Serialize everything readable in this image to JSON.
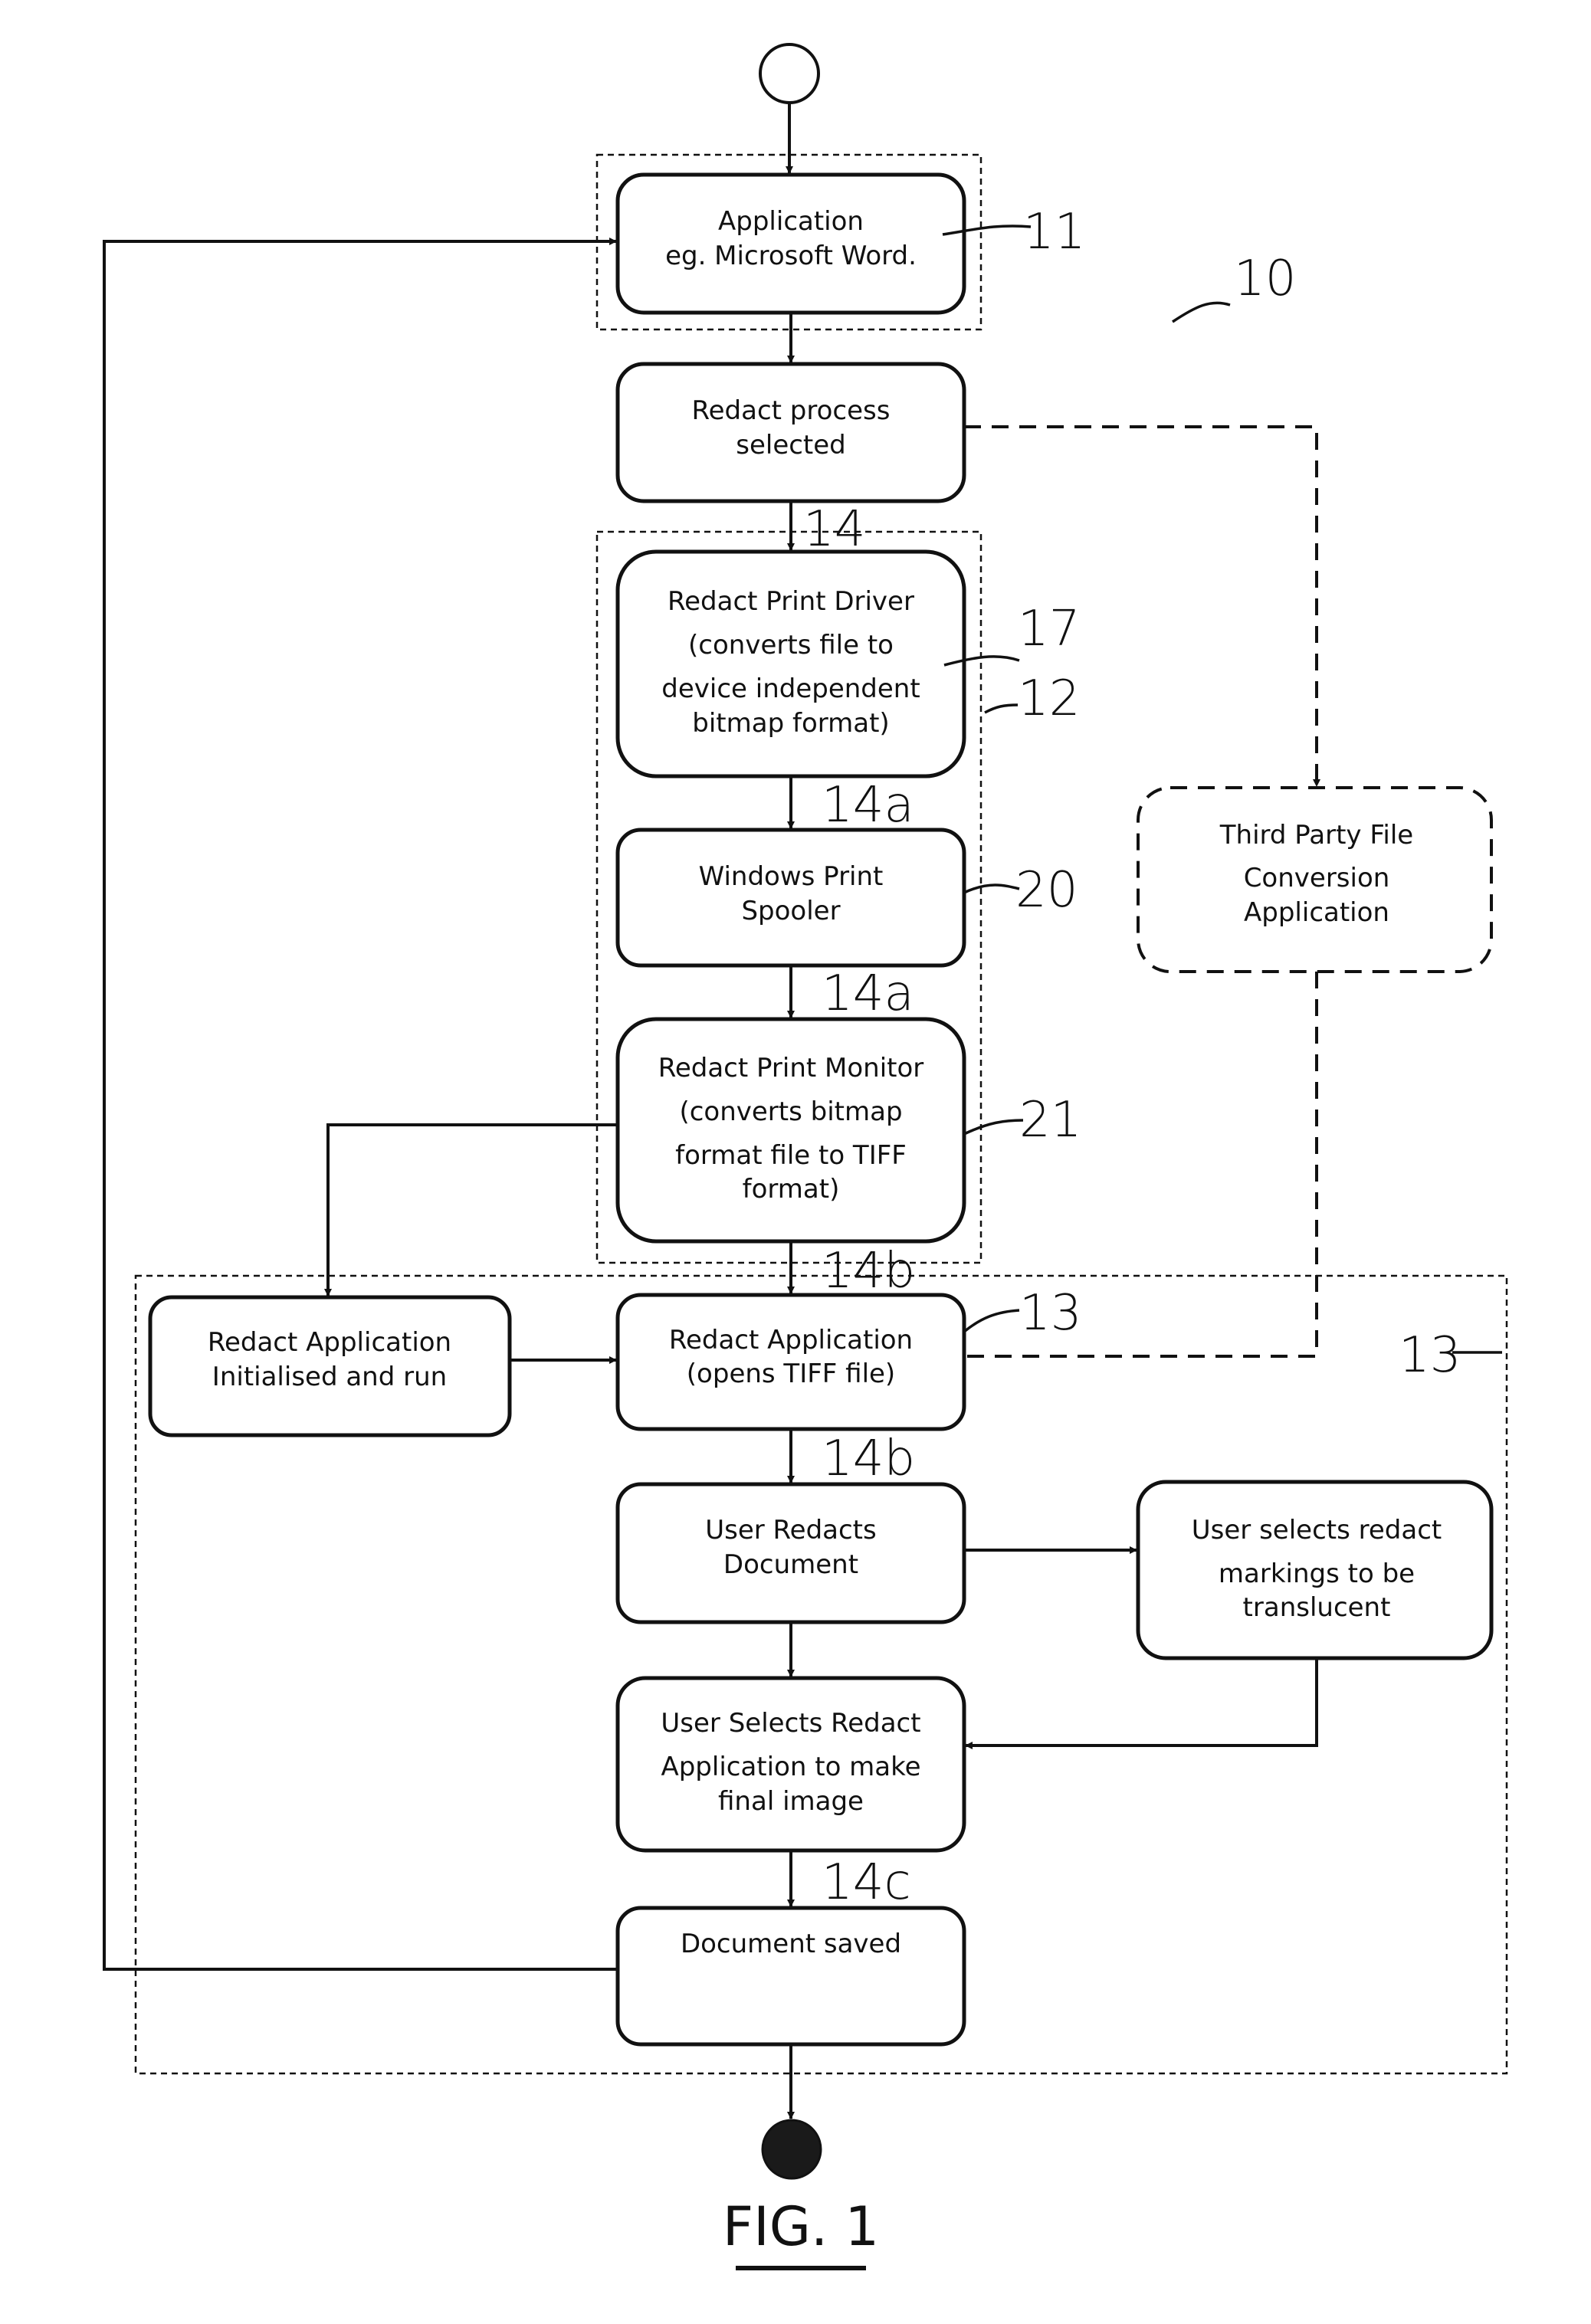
{
  "figure": {
    "caption": "FIG. 1",
    "overall_ref": "10"
  },
  "nodes": {
    "application": {
      "lines": [
        "Application",
        "eg. Microsoft Word."
      ],
      "ref": "11"
    },
    "redact_process": {
      "lines": [
        "Redact process",
        "selected"
      ]
    },
    "print_driver": {
      "lines": [
        "Redact Print Driver",
        "(converts file to",
        "device independent",
        "bitmap format)"
      ],
      "ref": "17"
    },
    "print_spooler": {
      "lines": [
        "Windows Print",
        "Spooler"
      ],
      "ref": "20"
    },
    "print_monitor": {
      "lines": [
        "Redact Print Monitor",
        "(converts bitmap",
        "format file to TIFF",
        "format)"
      ],
      "ref": "21"
    },
    "third_party": {
      "lines": [
        "Third Party File",
        "Conversion",
        "Application"
      ]
    },
    "app_init": {
      "lines": [
        "Redact Application",
        "Initialised and run"
      ]
    },
    "app_open": {
      "lines": [
        "Redact Application",
        "(opens TIFF file)"
      ],
      "ref": "13"
    },
    "user_redacts": {
      "lines": [
        "User Redacts",
        "Document"
      ]
    },
    "translucent": {
      "lines": [
        "User selects redact",
        "markings to be",
        "translucent"
      ]
    },
    "final_image": {
      "lines": [
        "User Selects Redact",
        "Application to make",
        "final image"
      ]
    },
    "saved": {
      "lines": [
        "Document saved"
      ]
    }
  },
  "groups": {
    "print_group_ref": "12",
    "redact_group_ref": "13"
  },
  "flow_labels": {
    "f14": "14",
    "f14a_1": "14a",
    "f14a_2": "14a",
    "f14b_1": "14b",
    "f14b_2": "14b",
    "f14c": "14c"
  }
}
